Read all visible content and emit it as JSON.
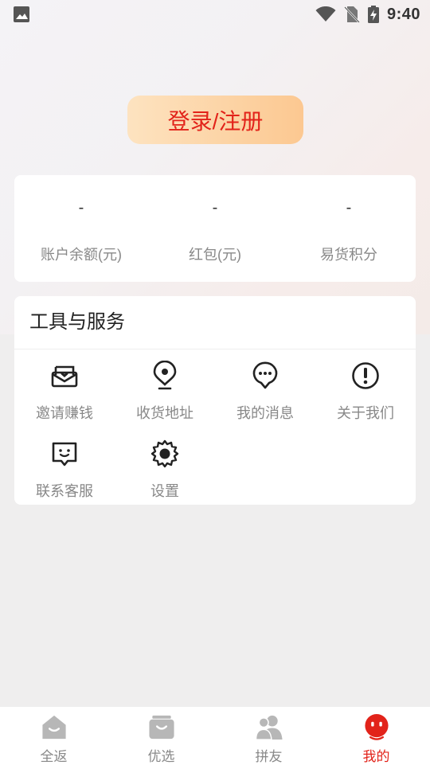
{
  "status_bar": {
    "time": "9:40"
  },
  "login": {
    "label": "登录/注册"
  },
  "stats": [
    {
      "value": "-",
      "label": "账户余额(元)"
    },
    {
      "value": "-",
      "label": "红包(元)"
    },
    {
      "value": "-",
      "label": "易货积分"
    }
  ],
  "tools": {
    "title": "工具与服务",
    "items": [
      {
        "label": "邀请赚钱",
        "icon": "invite-envelope-icon"
      },
      {
        "label": "收货地址",
        "icon": "location-pin-icon"
      },
      {
        "label": "我的消息",
        "icon": "message-bubble-icon"
      },
      {
        "label": "关于我们",
        "icon": "info-exclaim-icon"
      },
      {
        "label": "联系客服",
        "icon": "customer-service-icon"
      },
      {
        "label": "设置",
        "icon": "gear-icon"
      }
    ]
  },
  "tabs": [
    {
      "label": "全返",
      "icon": "home-icon",
      "active": false
    },
    {
      "label": "优选",
      "icon": "shopping-bag-icon",
      "active": false
    },
    {
      "label": "拼友",
      "icon": "friends-icon",
      "active": false
    },
    {
      "label": "我的",
      "icon": "profile-mascot-icon",
      "active": true
    }
  ],
  "colors": {
    "accent": "#e2231a",
    "login_bg_start": "#fde3c0",
    "login_bg_end": "#fcc891"
  }
}
